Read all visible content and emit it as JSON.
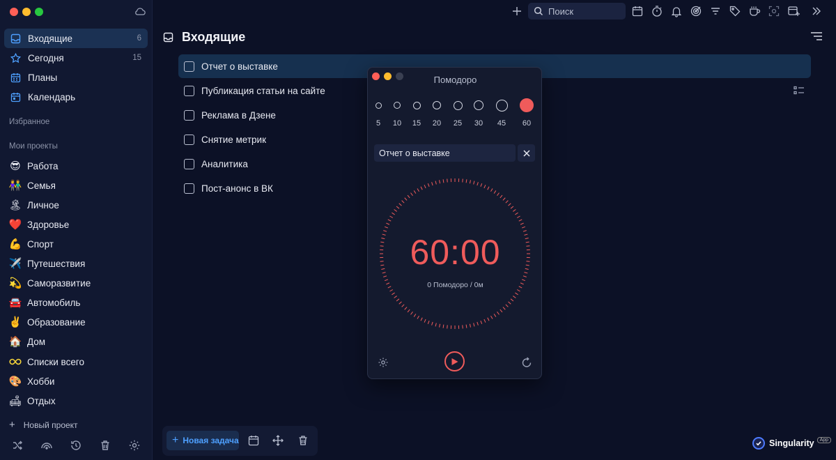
{
  "colors": {
    "accent": "#4ea0ff",
    "timer_red": "#ef5b5b",
    "traffic_red": "#ff5f57",
    "traffic_yellow": "#febc2e",
    "traffic_green": "#28c840"
  },
  "sidebar": {
    "nav": [
      {
        "label": "Входящие",
        "count": "6",
        "icon": "inbox-icon"
      },
      {
        "label": "Сегодня",
        "count": "15",
        "icon": "star-icon"
      },
      {
        "label": "Планы",
        "count": "",
        "icon": "calendar-grid-icon"
      },
      {
        "label": "Календарь",
        "count": "",
        "icon": "calendar-icon"
      }
    ],
    "favorites_label": "Избранное",
    "projects_label": "Мои проекты",
    "projects": [
      {
        "emoji": "😎",
        "label": "Работа"
      },
      {
        "emoji": "👫",
        "label": "Семья"
      },
      {
        "emoji": "🏝",
        "label": "Личное"
      },
      {
        "emoji": "❤️",
        "label": "Здоровье"
      },
      {
        "emoji": "💪",
        "label": "Спорт"
      },
      {
        "emoji": "✈️",
        "label": "Путешествия"
      },
      {
        "emoji": "💫",
        "label": "Саморазвитие"
      },
      {
        "emoji": "🚘",
        "label": "Автомобиль"
      },
      {
        "emoji": "✌️",
        "label": "Образование"
      },
      {
        "emoji": "🏠",
        "label": "Дом"
      },
      {
        "emoji": "♾",
        "label": "Списки всего"
      },
      {
        "emoji": "🎨",
        "label": "Хобби"
      },
      {
        "emoji": "🛋",
        "label": "Отдых"
      }
    ],
    "new_project_label": "Новый проект"
  },
  "toolbar": {
    "search_placeholder": "Поиск"
  },
  "main": {
    "title": "Входящие",
    "tasks": [
      "Отчет о выставке",
      "Публикация статьи на сайте",
      "Реклама в Дзене",
      "Снятие метрик",
      "Аналитика",
      "Пост-анонс в ВК"
    ],
    "new_task_label": "Новая задача"
  },
  "brand": {
    "name": "Singularity",
    "badge": "App"
  },
  "pomodoro": {
    "title": "Помодоро",
    "durations": [
      "5",
      "10",
      "15",
      "20",
      "25",
      "30",
      "45",
      "60"
    ],
    "selected_duration": "60",
    "task": "Отчет о выставке",
    "timer": "60:00",
    "summary": "0 Помодоро / 0м"
  }
}
